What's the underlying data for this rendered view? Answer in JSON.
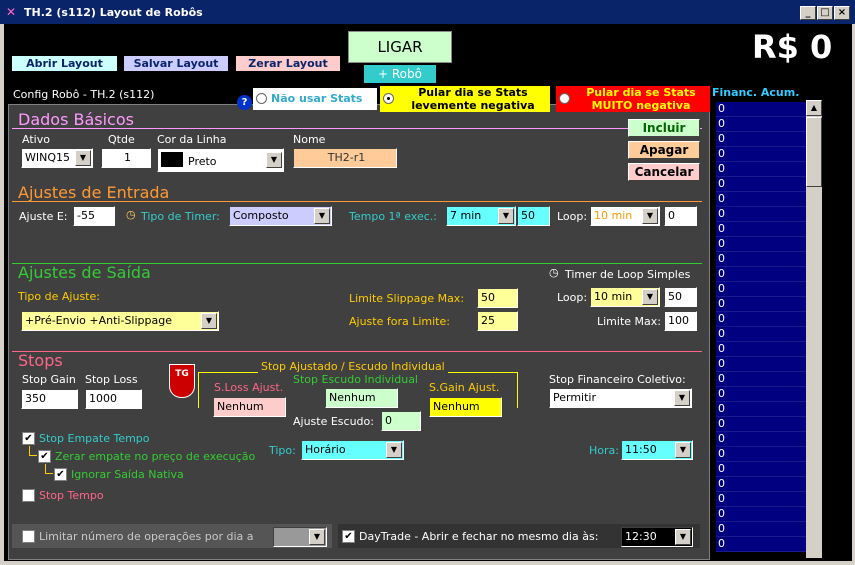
{
  "window": {
    "title": "TH.2  (s112)  Layout de Robôs",
    "min": "_",
    "max": "□",
    "close": "×"
  },
  "top": {
    "abrir": "Abrir Layout",
    "salvar": "Salvar Layout",
    "zerar": "Zerar Layout",
    "ligar": "LIGAR",
    "add_robo": "+ Robô",
    "money": "R$ 0"
  },
  "grid": {
    "header": "Financ. Acum.",
    "cell": "0"
  },
  "config": {
    "title": "Config Robô - TH.2  (s112)",
    "help": "?",
    "stats": {
      "nao_usar": "Não usar Stats",
      "pular_leve": "Pular dia se Stats levemente negativa",
      "pular_muito": "Pular dia se Stats MUITO negativa"
    }
  },
  "basicos": {
    "title": "Dados Básicos",
    "ativo_label": "Ativo",
    "ativo": "WINQ15",
    "qtde_label": "Qtde",
    "qtde": "1",
    "cor_label": "Cor da Linha",
    "cor": "Preto",
    "nome_label": "Nome",
    "nome": "TH2-r1",
    "incluir": "Incluir",
    "apagar": "Apagar",
    "cancelar": "Cancelar"
  },
  "entrada": {
    "title": "Ajustes de Entrada",
    "ajuste_label": "Ajuste E:",
    "ajuste": "-55",
    "timer_label": "Tipo de Timer:",
    "timer": "Composto",
    "tempo_label": "Tempo 1ª exec.:",
    "tempo": "7 min",
    "tempo_val": "50",
    "loop_label": "Loop:",
    "loop": "10 min",
    "loop_val": "0"
  },
  "saida": {
    "title": "Ajustes de Saída",
    "timer_loop": "Timer de Loop Simples",
    "tipo_label": "Tipo de Ajuste:",
    "tipo": "+Pré-Envio +Anti-Slippage",
    "limite_label": "Limite Slippage Max:",
    "limite": "50",
    "fora_label": "Ajuste fora Limite:",
    "fora": "25",
    "loop_label": "Loop:",
    "loop": "10 min",
    "loop_val": "50",
    "limmax_label": "Limite Max:",
    "limmax": "100"
  },
  "stops": {
    "title": "Stops",
    "gain_label": "Stop Gain",
    "gain": "350",
    "loss_label": "Stop Loss",
    "loss": "1000",
    "shield": "TG",
    "group_title": "Stop Ajustado / Escudo Individual",
    "sloss_label": "S.Loss Ajust.",
    "sloss": "Nenhum",
    "escudo_label": "Stop Escudo Individual",
    "escudo": "Nenhum",
    "sgain_label": "S.Gain Ajust.",
    "sgain": "Nenhum",
    "ajuste_escudo_label": "Ajuste Escudo:",
    "ajuste_escudo": "0",
    "fin_label": "Stop Financeiro Coletivo:",
    "fin": "Permitir",
    "empate": "Stop Empate Tempo",
    "zerar_empate": "Zerar empate no preço de execução",
    "ignorar": "Ignorar Saída Nativa",
    "tipo_label": "Tipo:",
    "tipo": "Horário",
    "hora_label": "Hora:",
    "hora": "11:50",
    "stop_tempo": "Stop Tempo",
    "limitar": "Limitar número de operações por dia a",
    "daytrade": "DayTrade - Abrir e fechar no mesmo dia às:",
    "daytrade_hora": "12:30"
  }
}
